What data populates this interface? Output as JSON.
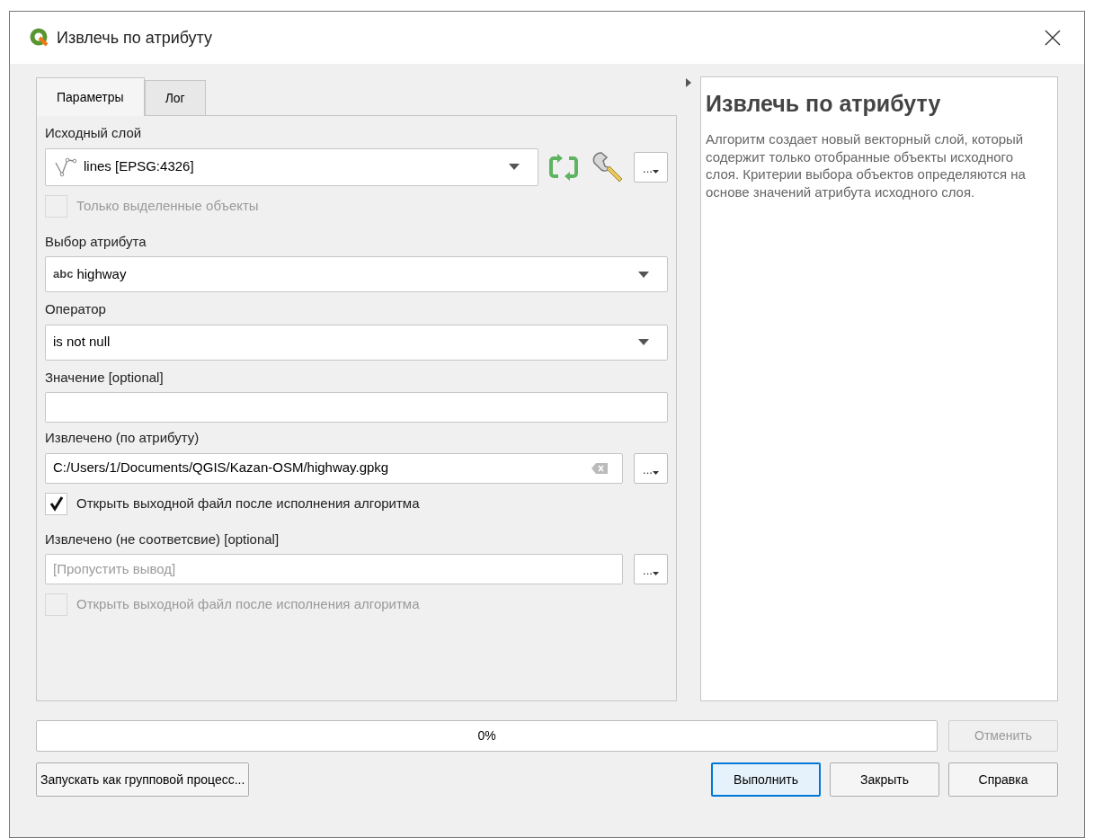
{
  "window": {
    "title": "Извлечь по атрибуту"
  },
  "tabs": [
    {
      "label": "Параметры",
      "selected": true
    },
    {
      "label": "Лог",
      "selected": false
    }
  ],
  "fields": [
    {
      "kind": "label",
      "text": "Исходный слой"
    },
    {
      "kind": "layer",
      "value": "lines [EPSG:4326]",
      "browse": "..."
    },
    {
      "kind": "checkbox",
      "text": "Только выделенные объекты",
      "checked": false,
      "disabled": true
    },
    {
      "kind": "label",
      "text": "Выбор атрибута"
    },
    {
      "kind": "select",
      "badge": "abc",
      "value": "highway"
    },
    {
      "kind": "label",
      "text": "Оператор"
    },
    {
      "kind": "select",
      "value": "is not null"
    },
    {
      "kind": "label",
      "text": "Значение [optional]"
    },
    {
      "kind": "text"
    },
    {
      "kind": "label",
      "text": "Извлечено (по атрибуту)"
    },
    {
      "kind": "file",
      "value": "C:/Users/1/Documents/QGIS/Kazan-OSM/highway.gpkg",
      "browse": "..."
    },
    {
      "kind": "checkbox",
      "text": "Открыть выходной файл после исполнения алгоритма",
      "checked": true,
      "disabled": false
    },
    {
      "kind": "label",
      "text": "Извлечено (не соответсвие) [optional]"
    },
    {
      "kind": "file",
      "placeholder": "[Пропустить вывод]",
      "browse": "..."
    },
    {
      "kind": "checkbox",
      "text": "Открыть выходной файл после исполнения алгоритма",
      "checked": false,
      "disabled": true
    }
  ],
  "help": {
    "title": "Извлечь по атрибуту",
    "text": "Алгоритм создает новый векторный слой, который содержит только отобранные объекты исходного слоя. Критерии выбора объектов определяются на основе значений атрибута исходного слоя."
  },
  "progress": {
    "level": 0,
    "text": "0%"
  },
  "cancel": {
    "label": "Отменить",
    "disabled": true
  },
  "batch_button": "Запускать как групповой процесс...",
  "buttons": [
    {
      "label": "Выполнить",
      "selected": true
    },
    {
      "label": "Закрыть",
      "selected": false
    },
    {
      "label": "Справка",
      "selected": false
    }
  ]
}
